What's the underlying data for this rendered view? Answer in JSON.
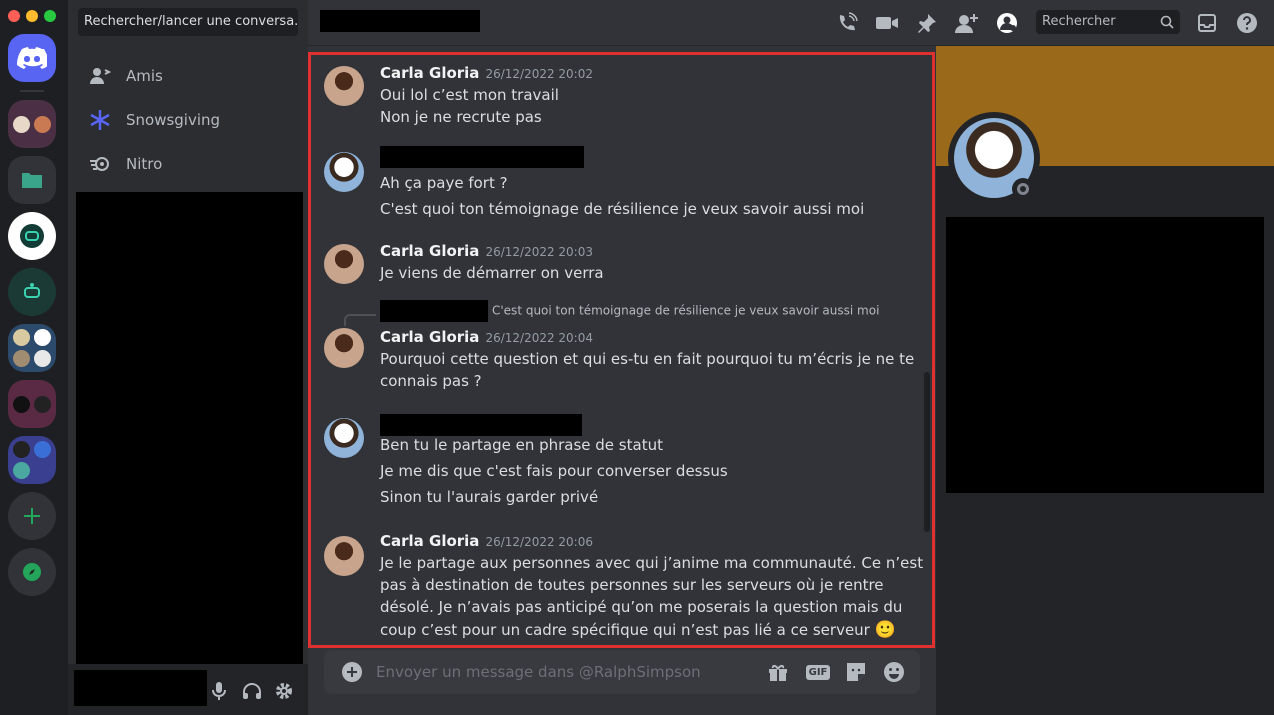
{
  "sidebar": {
    "search_placeholder": "Rechercher/lancer une conversa...",
    "items": [
      {
        "label": "Amis"
      },
      {
        "label": "Snowsgiving"
      },
      {
        "label": "Nitro"
      }
    ]
  },
  "header": {
    "search_label": "Rechercher"
  },
  "messages": [
    {
      "author": "Carla Gloria",
      "timestamp": "26/12/2022 20:02",
      "lines": [
        "Oui lol c’est mon travail",
        "Non je ne recrute pas"
      ]
    },
    {
      "author": "",
      "timestamp": "",
      "lines": [
        "Ah ça paye fort ?",
        "C'est quoi ton témoignage de résilience je veux savoir aussi moi"
      ]
    },
    {
      "author": "Carla Gloria",
      "timestamp": "26/12/2022 20:03",
      "lines": [
        "Je viens de démarrer on verra"
      ]
    },
    {
      "reply_to": "C'est quoi ton témoignage de résilience je veux savoir aussi moi",
      "author": "Carla Gloria",
      "timestamp": "26/12/2022 20:04",
      "lines": [
        "Pourquoi cette question et qui es-tu en fait pourquoi tu m’écris je ne te",
        "connais pas ?"
      ]
    },
    {
      "author": "",
      "timestamp": "",
      "lines": [
        "Ben tu le partage en phrase de statut",
        "Je me dis que c'est fais pour converser dessus",
        "Sinon tu l'aurais garder privé"
      ]
    },
    {
      "author": "Carla Gloria",
      "timestamp": "26/12/2022 20:06",
      "lines": [
        "Je le partage aux personnes avec qui j’anime ma communauté. Ce n’est",
        "pas à destination de toutes personnes sur les serveurs où je rentre",
        "désolé. Je n’avais pas anticipé qu’on me poserais la question mais du",
        "coup c’est pour un cadre spécifique qui n’est pas lié a ce serveur"
      ],
      "emoji": "🙂"
    }
  ],
  "composer": {
    "placeholder": "Envoyer un message dans @RalphSimpson",
    "gif_label": "GIF"
  },
  "colors": {
    "accent": "#5865f2",
    "highlight": "#e03131",
    "banner": "#9a6a1a",
    "green": "#23a55a"
  }
}
